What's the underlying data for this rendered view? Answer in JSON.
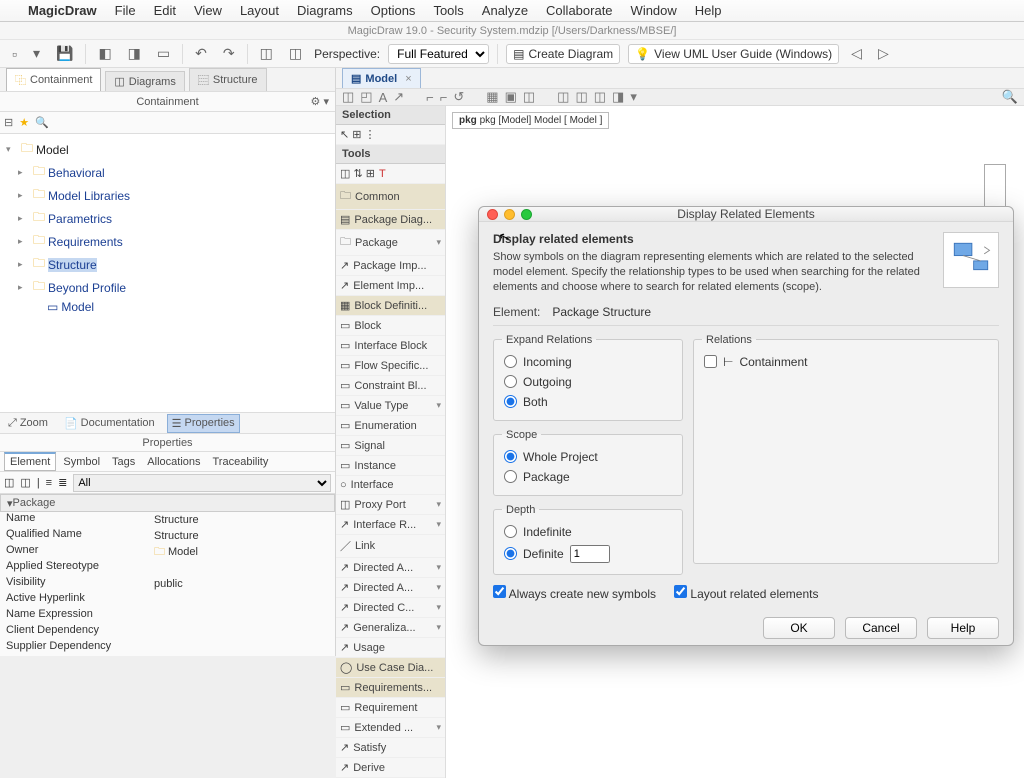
{
  "menubar": {
    "app": "MagicDraw",
    "items": [
      "File",
      "Edit",
      "View",
      "Layout",
      "Diagrams",
      "Options",
      "Tools",
      "Analyze",
      "Collaborate",
      "Window",
      "Help"
    ]
  },
  "window_title": "MagicDraw 19.0 - Security System.mdzip [/Users/Darkness/MBSE/]",
  "toolbar": {
    "perspective_label": "Perspective:",
    "perspective_value": "Full Featured",
    "create_diagram": "Create Diagram",
    "view_guide": "View UML User Guide (Windows)"
  },
  "left_tabs": {
    "containment": "Containment",
    "diagrams": "Diagrams",
    "structure": "Structure"
  },
  "left_title": "Containment",
  "tree": {
    "root": "Model",
    "nodes": [
      "Behavioral",
      "Model Libraries",
      "Parametrics",
      "Requirements",
      "Structure",
      "Beyond Profile",
      "Model"
    ]
  },
  "lower_tabs": {
    "zoom": "Zoom",
    "doc": "Documentation",
    "props": "Properties"
  },
  "lower_title": "Properties",
  "prop_tabs": [
    "Element",
    "Symbol",
    "Tags",
    "Allocations",
    "Traceability"
  ],
  "prop_filter": "All",
  "prop_head": "Package",
  "props": [
    {
      "n": "Name",
      "v": "Structure"
    },
    {
      "n": "Qualified Name",
      "v": "Structure"
    },
    {
      "n": "Owner",
      "v": "Model",
      "ico": true
    },
    {
      "n": "Applied Stereotype",
      "v": ""
    },
    {
      "n": "Visibility",
      "v": "public"
    },
    {
      "n": "Active Hyperlink",
      "v": ""
    },
    {
      "n": "Name Expression",
      "v": ""
    },
    {
      "n": "Client Dependency",
      "v": ""
    },
    {
      "n": "Supplier Dependency",
      "v": ""
    }
  ],
  "center_tab": "Model",
  "palette": {
    "selection": "Selection",
    "tools": "Tools",
    "common": "Common",
    "items": [
      "Package Diag...",
      "Package",
      "Package Imp...",
      "Element Imp...",
      "Block Definiti...",
      "Block",
      "Interface Block",
      "Flow Specific...",
      "Constraint Bl...",
      "Value Type",
      "Enumeration",
      "Signal",
      "Instance",
      "Interface",
      "Proxy Port",
      "Interface R...",
      "Link",
      "Directed A...",
      "Directed A...",
      "Directed C...",
      "Generaliza...",
      "Usage",
      "Use Case Dia...",
      "Requirements...",
      "Requirement",
      "Extended ...",
      "Satisfy",
      "Derive"
    ]
  },
  "canvas_frame": "pkg [Model] Model [ Model ]",
  "dialog": {
    "title": "Display Related Elements",
    "heading": "Display related elements",
    "desc": "Show symbols on the diagram representing elements which are related to the selected model element. Specify the relationship types to be used when searching for the related elements and choose where to search for related elements (scope).",
    "element_label": "Element:",
    "element_value": "Package Structure",
    "expand_legend": "Expand Relations",
    "incoming": "Incoming",
    "outgoing": "Outgoing",
    "both": "Both",
    "scope_legend": "Scope",
    "whole": "Whole Project",
    "package": "Package",
    "depth_legend": "Depth",
    "indefinite": "Indefinite",
    "definite": "Definite",
    "definite_val": "1",
    "relations_legend": "Relations",
    "relation_containment": "Containment",
    "chk_always": "Always create new symbols",
    "chk_layout": "Layout related elements",
    "btn_ok": "OK",
    "btn_cancel": "Cancel",
    "btn_help": "Help"
  }
}
